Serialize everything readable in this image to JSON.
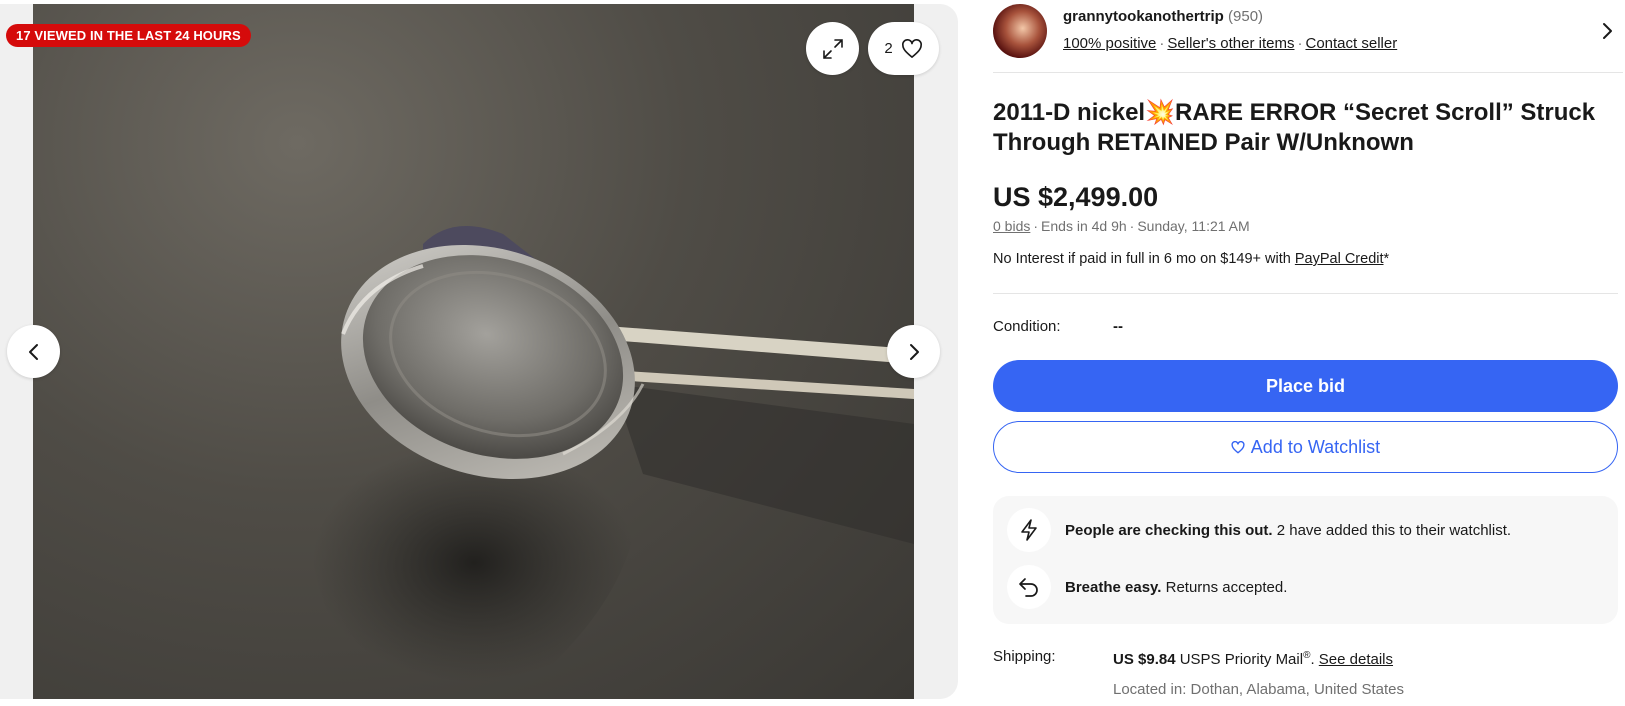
{
  "gallery": {
    "viewed_badge": "17 VIEWED IN THE LAST 24 HOURS",
    "watch_count": "2",
    "icons": {
      "expand": "expand-icon",
      "heart": "heart-icon",
      "prev": "chevron-left-icon",
      "next": "chevron-right-icon"
    }
  },
  "seller": {
    "name": "grannytookanothertrip",
    "feedback_count": "(950)",
    "positive": "100% positive",
    "other_items": "Seller's other items",
    "contact": "Contact seller"
  },
  "listing": {
    "title_part1": "2011-D nickel",
    "title_emoji": "💥",
    "title_part2": "RARE ERROR “Secret Scroll” Struck Through RETAINED Pair W/Unknown",
    "price": "US $2,499.00",
    "bids": "0 bids",
    "ends": "Ends in 4d 9h",
    "end_time": "Sunday, 11:21 AM",
    "credit_prefix": "No Interest if paid in full in 6 mo on $149+ with ",
    "credit_link": "PayPal Credit",
    "credit_suffix": "*",
    "condition_label": "Condition:",
    "condition_value": "--"
  },
  "actions": {
    "place_bid": "Place bid",
    "add_watchlist": "Add to Watchlist"
  },
  "signals": {
    "checking_bold": "People are checking this out.",
    "checking_text": " 2 have added this to their watchlist.",
    "returns_bold": "Breathe easy.",
    "returns_text": " Returns accepted."
  },
  "shipping": {
    "label": "Shipping:",
    "cost": "US $9.84",
    "service": " USPS Priority Mail",
    "reg": "®",
    "period": ". ",
    "details": "See details",
    "location": "Located in: Dothan, Alabama, United States"
  },
  "colors": {
    "accent": "#3665f3",
    "badge": "#d50b0b"
  }
}
